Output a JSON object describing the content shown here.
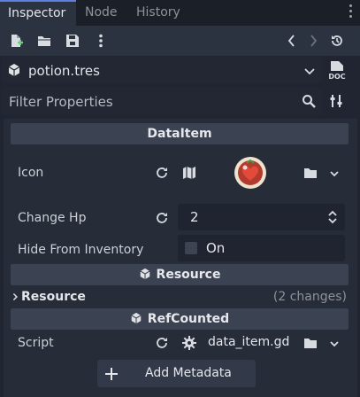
{
  "tabs": [
    {
      "label": "Inspector",
      "active": true
    },
    {
      "label": "Node",
      "active": false
    },
    {
      "label": "History",
      "active": false
    }
  ],
  "resource": {
    "name": "potion.tres"
  },
  "filter": {
    "placeholder": "Filter Properties"
  },
  "sections": {
    "data_item": "DataItem",
    "resource": "Resource",
    "ref_counted": "RefCounted"
  },
  "props": {
    "icon_label": "Icon",
    "change_hp_label": "Change Hp",
    "change_hp_value": "2",
    "hide_label": "Hide From Inventory",
    "hide_value": "On",
    "resource_group": "Resource",
    "resource_changes": "(2 changes)",
    "script_label": "Script",
    "script_value": "data_item.gd"
  },
  "add_metadata_label": "Add Metadata",
  "colors": {
    "accent": "#5c7fe0",
    "background": "#202531",
    "section": "#3b4252"
  }
}
